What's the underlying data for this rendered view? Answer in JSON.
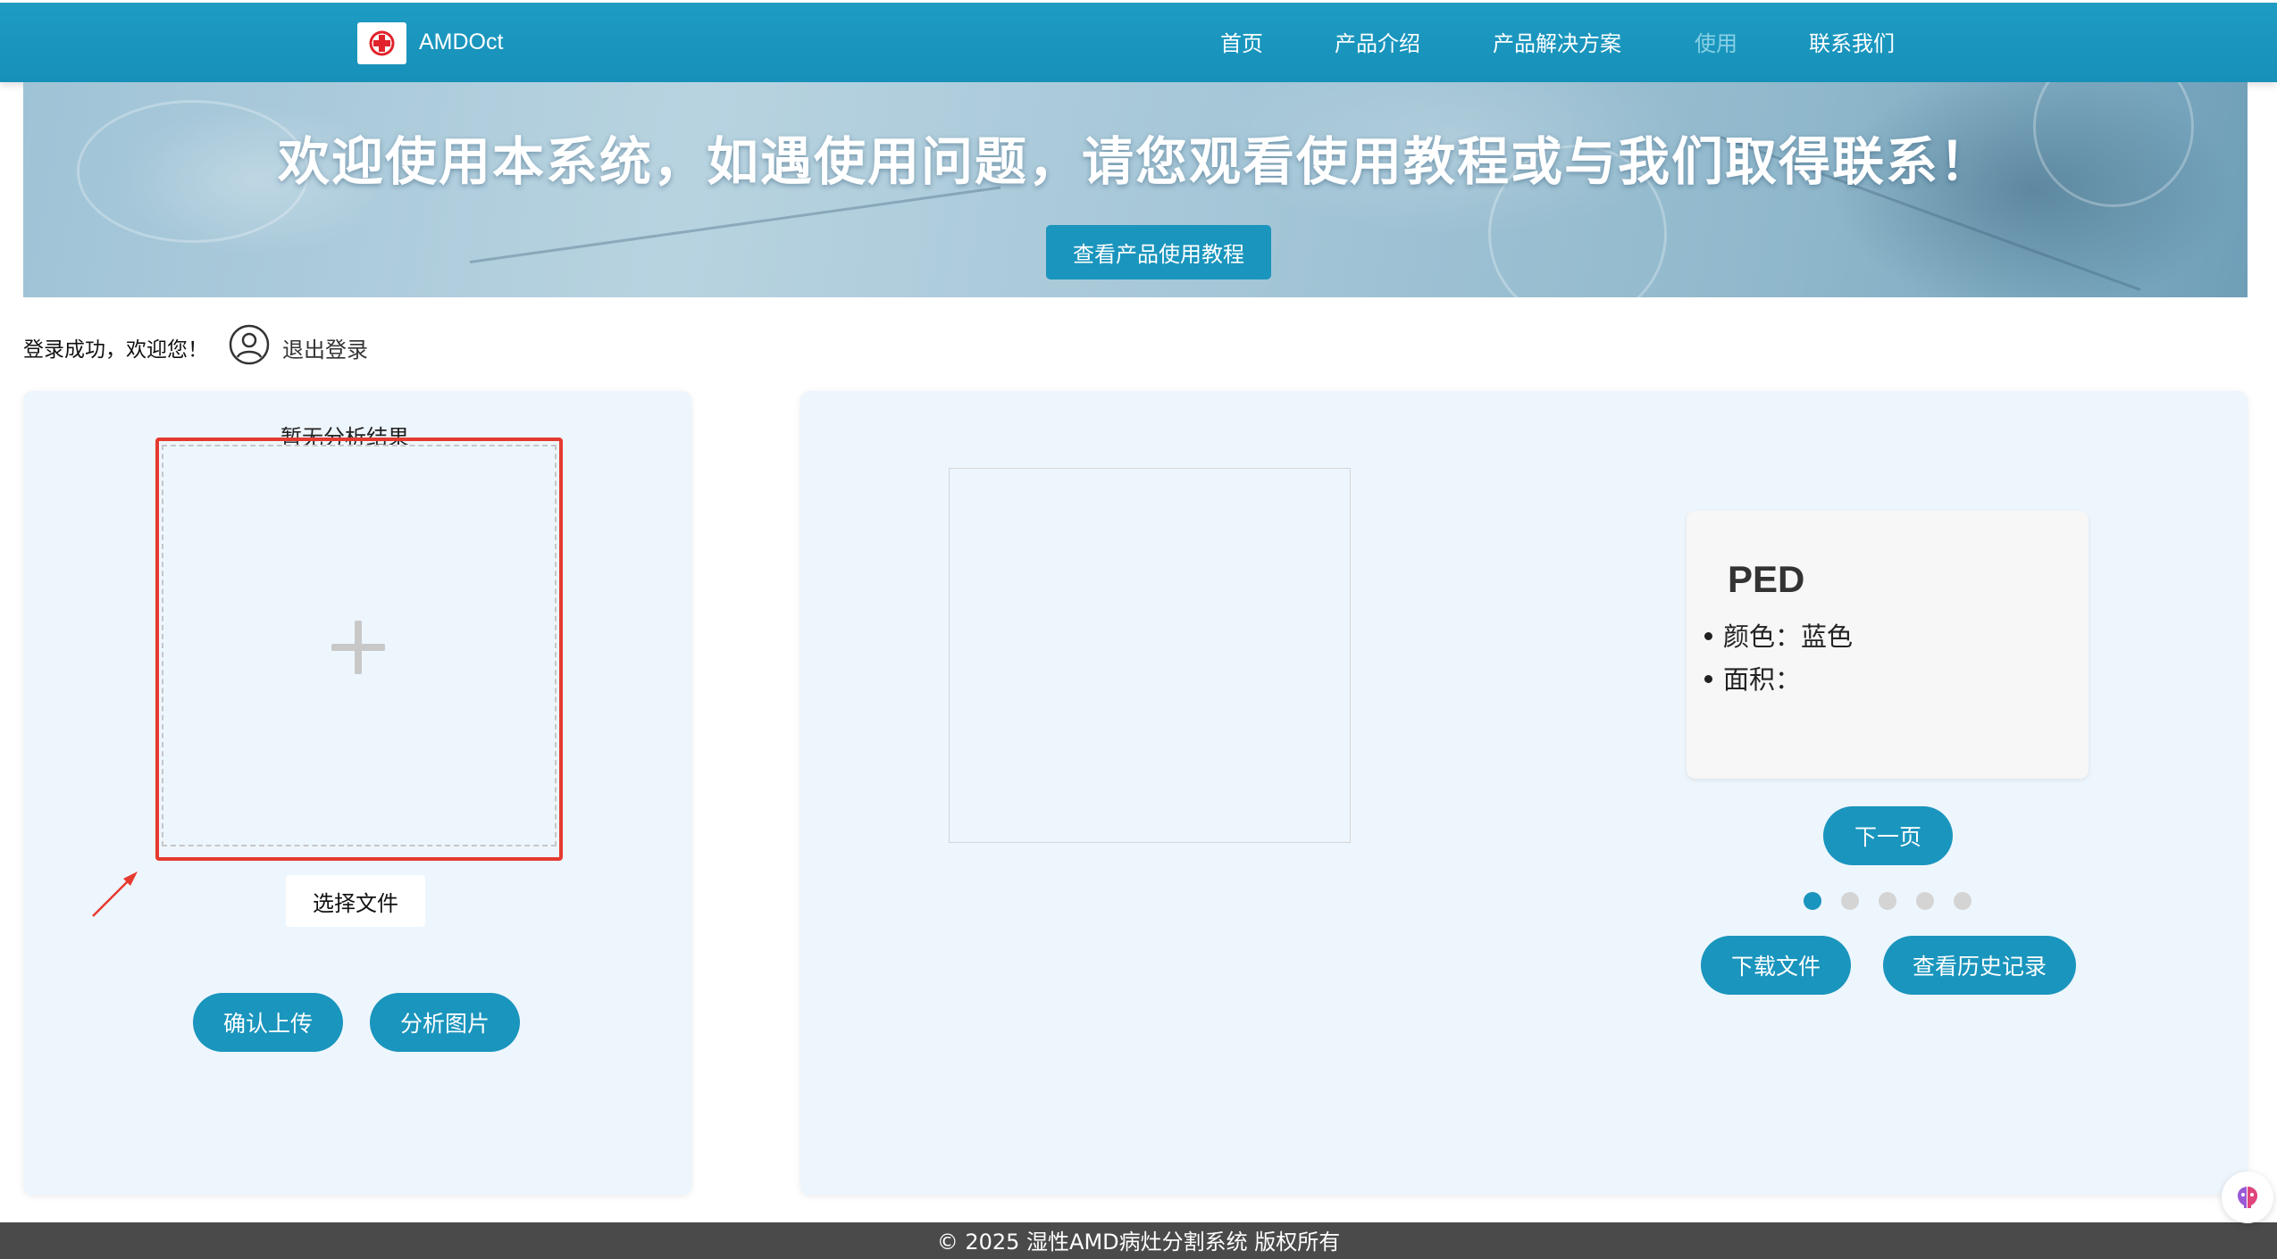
{
  "nav": {
    "brand": "AMDOct",
    "items": [
      {
        "label": "首页"
      },
      {
        "label": "产品介绍"
      },
      {
        "label": "产品解决方案"
      },
      {
        "label": "使用"
      },
      {
        "label": "联系我们"
      }
    ],
    "active_item": "使用"
  },
  "banner": {
    "title": "欢迎使用本系统，如遇使用问题，请您观看使用教程或与我们取得联系！",
    "tutorial_button": "查看产品使用教程"
  },
  "user": {
    "status": "登录成功，欢迎您！",
    "logout": "退出登录",
    "icon": "user-icon"
  },
  "left_panel": {
    "result_text": "暂无分析结果",
    "upload_icon": "plus-icon",
    "choose_file": "选择文件",
    "confirm_upload": "确认上传",
    "analyze_image": "分析图片"
  },
  "right_panel": {
    "card": {
      "title": "PED",
      "color_label": "颜色：蓝色",
      "area_label": "面积："
    },
    "next_button": "下一页",
    "page_count": 5,
    "current_page": 1,
    "download_button": "下载文件",
    "history_button": "查看历史记录"
  },
  "footer": {
    "copyright": "© 2025 湿性AMD病灶分割系统 版权所有"
  },
  "colors": {
    "primary": "#1a95bd",
    "nav_bg": "#1e9cc4",
    "panel_bg": "#eef6fd",
    "highlight": "#e53a30",
    "footer_bg": "#4a4a4a"
  }
}
